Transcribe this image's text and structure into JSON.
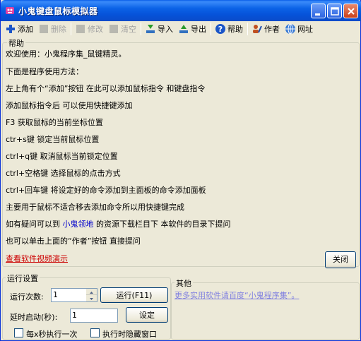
{
  "window": {
    "title": "小鬼键盘鼠标模拟器"
  },
  "toolbar": {
    "add": "添加",
    "delete": "删除",
    "modify": "修改",
    "clear": "清空",
    "import": "导入",
    "export": "导出",
    "help": "帮助",
    "author": "作者",
    "website": "网址"
  },
  "help": {
    "group_title": "帮助",
    "lines": [
      "欢迎使用：小鬼程序集_鼠键精灵。",
      "下面是程序使用方法：",
      "左上角有个“添加”按钮 在此可以添加鼠标指令 和键盘指令",
      "添加鼠标指令后 可以使用快捷键添加",
      "F3 获取鼠标的当前坐标位置",
      "ctr+s键 锁定当前鼠标位置",
      "ctrl+q键 取消鼠标当前锁定位置",
      "ctrl+空格键 选择鼠标的点击方式",
      "ctrl+回车键 将设定好的命令添加到主面板的命令添加面板",
      "主要用于鼠标不适合移去添加命令所以用快捷键完成",
      "也可以单击上面的“作者”按钮 直接提问"
    ],
    "question_line": {
      "before": "如有疑问可以到",
      "link": "小鬼领地",
      "after": "的资源下载栏目下 本软件的目录下提问"
    },
    "video_link": "查看软件视频演示",
    "close_button": "关闭"
  },
  "run_settings": {
    "group_title": "运行设置",
    "run_count_label": "运行次数:",
    "run_count_value": "1",
    "run_button": "运行(F11)",
    "delay_label": "延时启动(秒):",
    "delay_value": "1",
    "set_button": "设定",
    "every_x_sec_label": "每x秒执行一次",
    "hide_window_label": "执行时隐藏窗口"
  },
  "other": {
    "group_title": "其他",
    "link_text": "更多实用软件请百度“小鬼程序集”。"
  }
}
